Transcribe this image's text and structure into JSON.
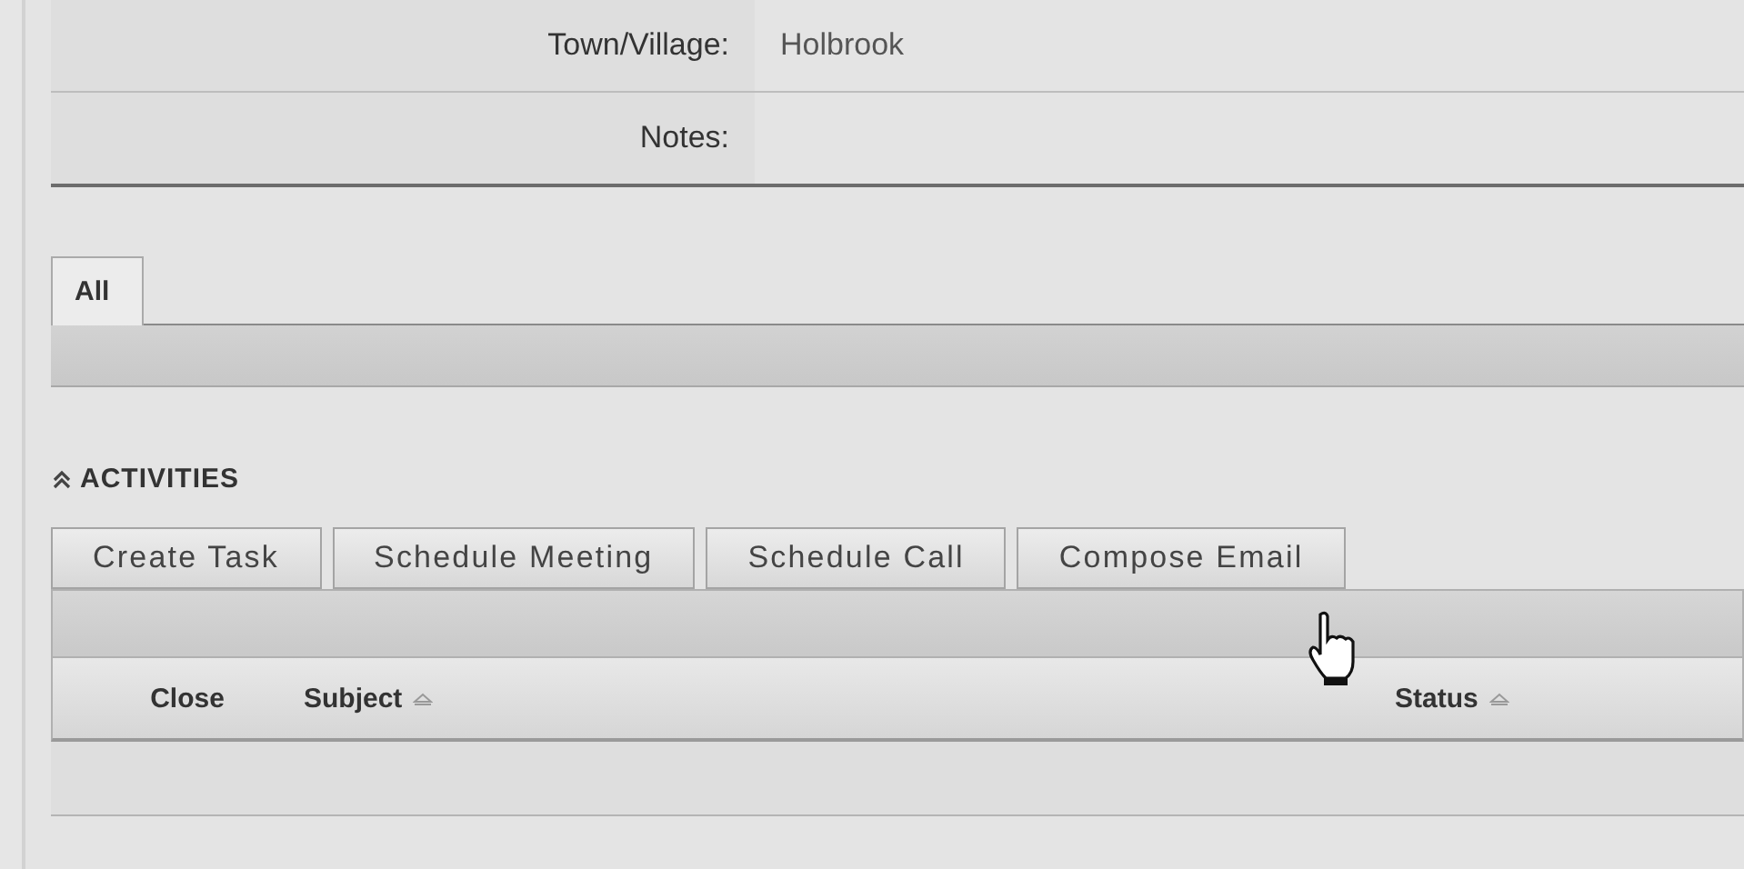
{
  "form": {
    "fields": [
      {
        "label": "Town/Village:",
        "value": "Holbrook"
      },
      {
        "label": "Notes:"
      }
    ]
  },
  "tabs": [
    {
      "label": "All",
      "selected": true
    }
  ],
  "activities": {
    "title": "ACTIVITIES",
    "expanded": true,
    "buttons": [
      "Create Task",
      "Schedule Meeting",
      "Schedule Call",
      "Compose Email"
    ],
    "columns": [
      {
        "label": "Close",
        "sortable": false
      },
      {
        "label": "Subject",
        "sortable": true
      },
      {
        "label": "Status",
        "sortable": true
      }
    ]
  }
}
